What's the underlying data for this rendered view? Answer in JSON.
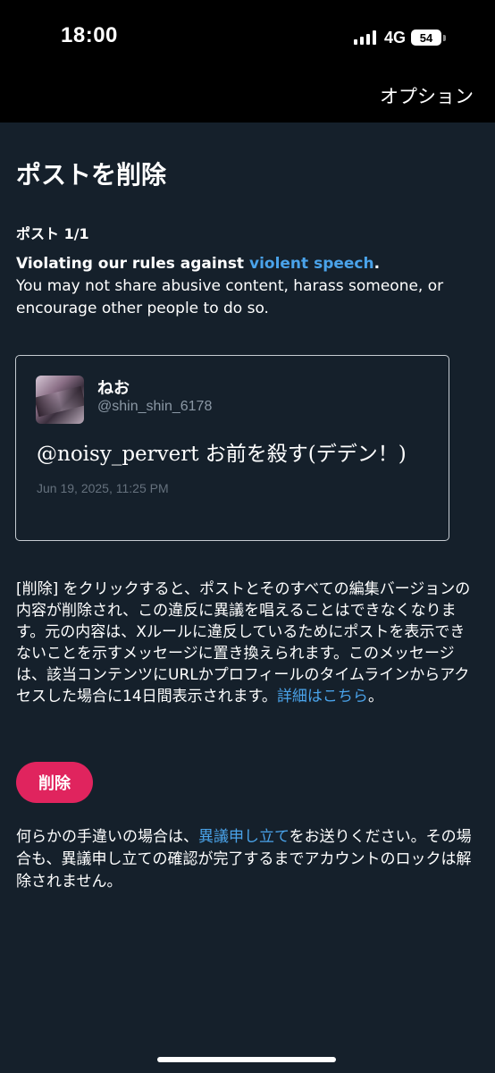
{
  "status_bar": {
    "time": "18:00",
    "network": "4G",
    "battery": "54"
  },
  "header": {
    "options_label": "オプション"
  },
  "page": {
    "title": "ポストを削除",
    "post_count": "ポスト 1/1",
    "violation_prefix": "Violating our rules against ",
    "violation_link": "violent speech",
    "violation_suffix": ".",
    "violation_detail": "You may not share abusive content, harass someone, or encourage other people to do so."
  },
  "post": {
    "display_name": "ねお",
    "handle": "@shin_shin_6178",
    "text": "@noisy_pervert お前を殺す(デデン！)",
    "date": "Jun 19, 2025, 11:25 PM"
  },
  "explanation": {
    "text": "[削除] をクリックすると、ポストとそのすべての編集バージョンの内容が削除され、この違反に異議を唱えることはできなくなります。元の内容は、Xルールに違反しているためにポストを表示できないことを示すメッセージに置き換えられます。このメッセージは、該当コンテンツにURLかプロフィールのタイムラインからアクセスした場合に14日間表示されます。",
    "link": "詳細はこちら",
    "suffix": "。"
  },
  "actions": {
    "delete_label": "削除"
  },
  "appeal": {
    "prefix": "何らかの手違いの場合は、",
    "link": "異議申し立て",
    "suffix": "をお送りください。その場合も、異議申し立ての確認が完了するまでアカウントのロックは解除されません。"
  },
  "colors": {
    "background": "#15202b",
    "link": "#4aa3ea",
    "delete_button": "#e0245e"
  }
}
